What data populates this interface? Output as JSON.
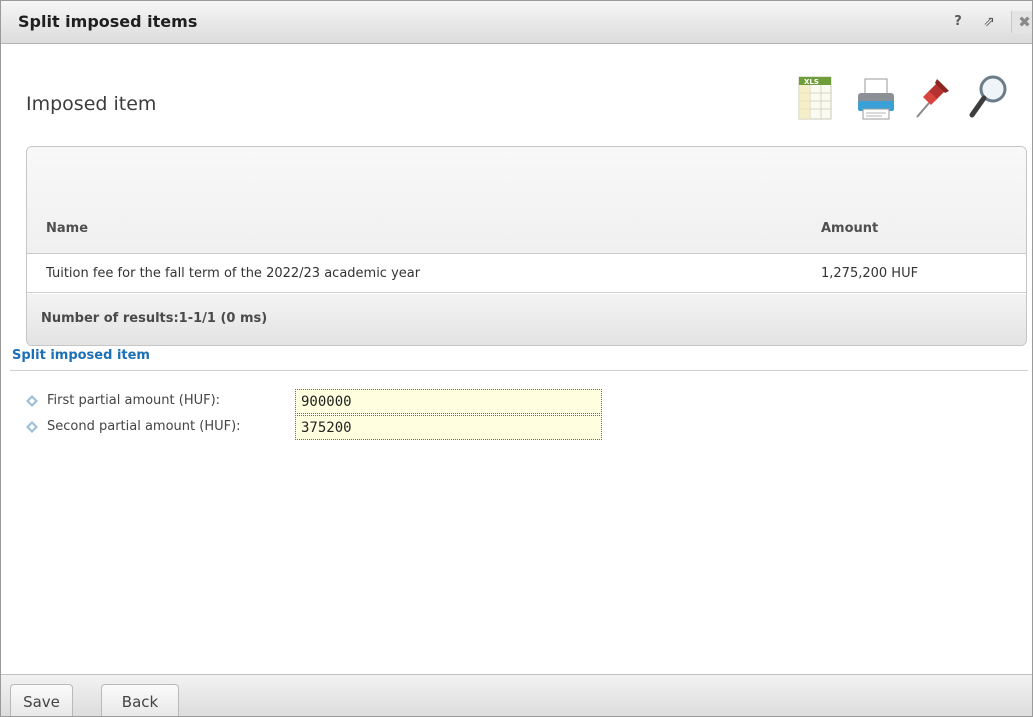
{
  "window": {
    "title": "Split imposed items",
    "help_label": "?",
    "popout_label": "⇗",
    "close_label": "✖"
  },
  "section": {
    "heading": "Imposed item"
  },
  "toolbar": {
    "icons": [
      "xls-export-icon",
      "print-icon",
      "pin-icon",
      "search-icon"
    ]
  },
  "grid": {
    "columns": [
      "Name",
      "Amount"
    ],
    "rows": [
      {
        "name": "Tuition fee for the fall term of the 2022/23 academic year",
        "amount": "1,275,200 HUF"
      }
    ],
    "results_text": "Number of results:1-1/1 (0 ms)"
  },
  "split": {
    "title": "Split imposed item",
    "fields": [
      {
        "label": "First partial amount (HUF):",
        "value": "900000"
      },
      {
        "label": "Second partial amount (HUF):",
        "value": "375200"
      }
    ]
  },
  "buttons": {
    "save": "Save",
    "back": "Back"
  },
  "colors": {
    "link_blue": "#1f6fb4",
    "input_bg": "#ffffe0",
    "input_border": "#e23b3b"
  }
}
